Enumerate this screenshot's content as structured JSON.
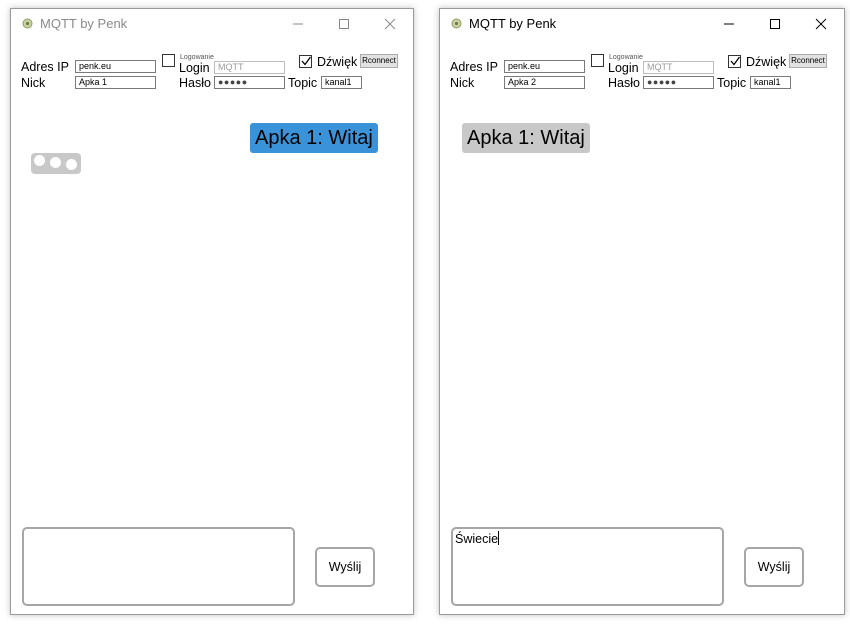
{
  "windows": [
    {
      "title": "MQTT by Penk",
      "title_active": false,
      "labels": {
        "ip": "Adres IP",
        "nick": "Nick",
        "login_group": "Logowanie",
        "login": "Login",
        "password": "Hasło",
        "sound": "Dźwięk",
        "topic": "Topic"
      },
      "fields": {
        "ip": "penk.eu",
        "nick": "Apka 1",
        "login": "MQTT",
        "password": "●●●●●",
        "topic": "kanal1"
      },
      "login_checked": false,
      "sound_checked": true,
      "reconnect_label": "Rconnect",
      "messages": [
        {
          "text": "Apka 1: Witaj",
          "own": true
        }
      ],
      "typing_indicator": true,
      "message_input": "",
      "send_label": "Wyślij"
    },
    {
      "title": "MQTT by Penk",
      "title_active": true,
      "labels": {
        "ip": "Adres IP",
        "nick": "Nick",
        "login_group": "Logowanie",
        "login": "Login",
        "password": "Hasło",
        "sound": "Dźwięk",
        "topic": "Topic"
      },
      "fields": {
        "ip": "penk.eu",
        "nick": "Apka 2",
        "login": "MQTT",
        "password": "●●●●●",
        "topic": "kanal1"
      },
      "login_checked": false,
      "sound_checked": true,
      "reconnect_label": "Rconnect",
      "messages": [
        {
          "text": "Apka 1: Witaj",
          "own": false
        }
      ],
      "typing_indicator": false,
      "message_input": "Świecie",
      "send_label": "Wyślij"
    }
  ],
  "colors": {
    "own_bubble": "#3a93d8",
    "other_bubble": "#c8c8c8",
    "border": "#a6a6a6"
  },
  "icons": {
    "app": "app-icon",
    "minimize": "minimize-icon",
    "maximize": "maximize-icon",
    "close": "close-icon",
    "check": "check-icon"
  }
}
